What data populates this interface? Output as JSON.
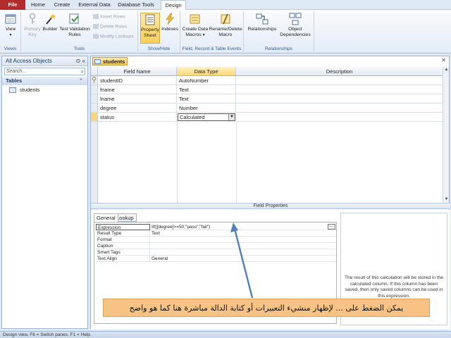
{
  "tabs": [
    "File",
    "Home",
    "Create",
    "External Data",
    "Database Tools",
    "Design"
  ],
  "ribbon": {
    "views": {
      "button": "View",
      "group": "Views"
    },
    "tools": {
      "primary_key": "Primary Key",
      "builder": "Builder",
      "test_validation": "Test Validation Rules",
      "insert_rows": "Insert Rows",
      "delete_rows": "Delete Rows",
      "modify_lookups": "Modify Lookups",
      "group": "Tools"
    },
    "show_hide": {
      "property_sheet": "Property Sheet",
      "indexes": "Indexes",
      "group": "Show/Hide"
    },
    "field_events": {
      "create_macros": "Create Data Macros",
      "rename_delete": "Rename/Delete Macro",
      "group": "Field, Record & Table Events"
    },
    "relationships": {
      "relationships": "Relationships",
      "object_dependencies": "Object Dependencies",
      "group": "Relationships"
    }
  },
  "nav": {
    "title": "All Access Objects",
    "search_placeholder": "Search...",
    "section": "Tables",
    "items": [
      "students"
    ]
  },
  "doc": {
    "tab": "students",
    "headers": {
      "field": "Field Name",
      "type": "Data Type",
      "desc": "Description"
    },
    "rows": [
      {
        "field": "studentID",
        "type": "AutoNumber",
        "desc": ""
      },
      {
        "field": "fname",
        "type": "Text",
        "desc": ""
      },
      {
        "field": "lname",
        "type": "Text",
        "desc": ""
      },
      {
        "field": "degree",
        "type": "Number",
        "desc": ""
      },
      {
        "field": "status",
        "type": "Calculated",
        "desc": ""
      }
    ],
    "field_properties_label": "Field Properties"
  },
  "props": {
    "tabs": [
      "General",
      "Lookup"
    ],
    "rows": [
      {
        "label": "Expression",
        "value": "IIf([degree]>=50;\"pass\";\"fail\")"
      },
      {
        "label": "Result Type",
        "value": "Text"
      },
      {
        "label": "Format",
        "value": ""
      },
      {
        "label": "Caption",
        "value": ""
      },
      {
        "label": "Smart Tags",
        "value": ""
      },
      {
        "label": "Text Align",
        "value": "General"
      }
    ],
    "help": "The result of this calculation will be stored in the calculated column. If this column has been saved, then only saved columns can be used in this expression."
  },
  "callout": "يمكن الضغط على ... لإظهار منشيء التعبيرات أو كتابة الدالة مباشرة هنا كما هو واضح",
  "status_bar": "Design view.  F6 = Switch panes.  F1 = Help.",
  "colors": {
    "file_tab": "#b32c2c",
    "callout": "#f7c384",
    "arrow": "#4f7fb8"
  }
}
